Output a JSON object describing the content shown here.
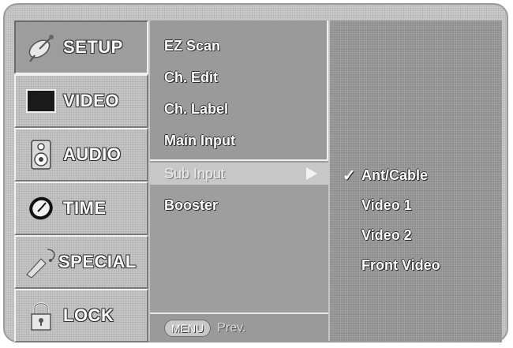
{
  "categories": [
    {
      "label": "SETUP",
      "icon": "satellite-dish-icon"
    },
    {
      "label": "VIDEO",
      "icon": "screen-icon"
    },
    {
      "label": "AUDIO",
      "icon": "speaker-icon"
    },
    {
      "label": "TIME",
      "icon": "clock-icon"
    },
    {
      "label": "SPECIAL",
      "icon": "magic-wand-icon"
    },
    {
      "label": "LOCK",
      "icon": "padlock-icon"
    }
  ],
  "menu": {
    "items": [
      "EZ Scan",
      "Ch. Edit",
      "Ch. Label",
      "Main Input",
      "Sub Input",
      "Booster"
    ],
    "bottom": {
      "menu_button": "MENU",
      "prev_label": "Prev."
    }
  },
  "options": {
    "checkmark": "✓",
    "items": [
      "Ant/Cable",
      "Video 1",
      "Video 2",
      "Front Video"
    ]
  }
}
